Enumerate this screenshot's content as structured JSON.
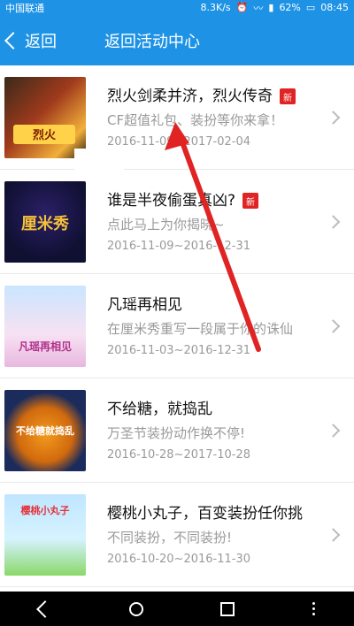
{
  "status": {
    "carrier": "中国联通",
    "speed": "8.3K/s",
    "battery": "62%",
    "time": "08:45"
  },
  "topbar": {
    "back_label": "返回",
    "title": "返回活动中心"
  },
  "items": [
    {
      "title": "烈火剑柔并济，烈火传奇",
      "badge": "新",
      "desc": "CF超值礼包、装扮等你来拿！",
      "date": "2016-11-09~2017-02-04"
    },
    {
      "title": "谁是半夜偷蛋真凶?",
      "badge": "新",
      "desc": "点此马上为你揭晓~",
      "date": "2016-11-09~2016-12-31"
    },
    {
      "title": "凡瑶再相见",
      "desc": "在厘米秀重写一段属于你的诛仙",
      "date": "2016-11-03~2016-12-31"
    },
    {
      "title": "不给糖，就捣乱",
      "desc": "万圣节装扮动作换不停!",
      "date": "2016-10-28~2017-10-28"
    },
    {
      "title": "樱桃小丸子，百变装扮任你挑",
      "desc": "不同装扮，不同装扮!",
      "date": "2016-10-20~2016-11-30"
    }
  ],
  "thumbs": [
    {
      "label": "烈火"
    },
    {
      "label": "厘米秀"
    },
    {
      "label": "凡瑶再相见"
    },
    {
      "label": "不给糖就捣乱"
    },
    {
      "label": "樱桃小丸子"
    }
  ]
}
